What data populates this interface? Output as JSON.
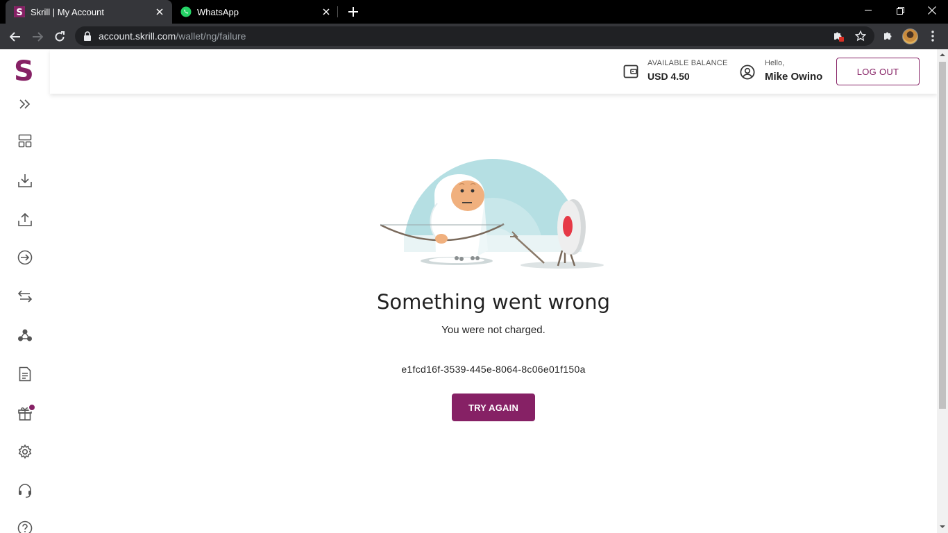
{
  "browser": {
    "tabs": [
      {
        "title": "Skrill | My Account",
        "active": true,
        "icon": "skrill-favicon"
      },
      {
        "title": "WhatsApp",
        "active": false,
        "icon": "whatsapp-favicon"
      }
    ],
    "url": {
      "host": "account.skrill.com",
      "path": "/wallet/ng/failure"
    }
  },
  "sidebar": {
    "logo": "S",
    "items": [
      {
        "icon": "expand-icon"
      },
      {
        "icon": "dashboard-icon"
      },
      {
        "icon": "deposit-icon"
      },
      {
        "icon": "withdraw-icon"
      },
      {
        "icon": "send-icon"
      },
      {
        "icon": "transfer-icon"
      },
      {
        "icon": "crypto-icon"
      },
      {
        "icon": "history-icon"
      },
      {
        "icon": "rewards-icon"
      },
      {
        "icon": "settings-icon"
      },
      {
        "icon": "support-icon"
      },
      {
        "icon": "help-icon"
      }
    ]
  },
  "header": {
    "balance_label": "AVAILABLE BALANCE",
    "balance_value": "USD 4.50",
    "hello": "Hello,",
    "user_name": "Mike Owino",
    "logout_label": "LOG OUT"
  },
  "main": {
    "heading": "Something went wrong",
    "subtext": "You were not charged.",
    "reference": "e1fcd16f-3539-445e-8064-8c06e01f150a",
    "try_again_label": "TRY AGAIN"
  },
  "colors": {
    "brand": "#862165",
    "chrome_dark": "#35363a",
    "illustration_sky": "#b5dfe3"
  }
}
